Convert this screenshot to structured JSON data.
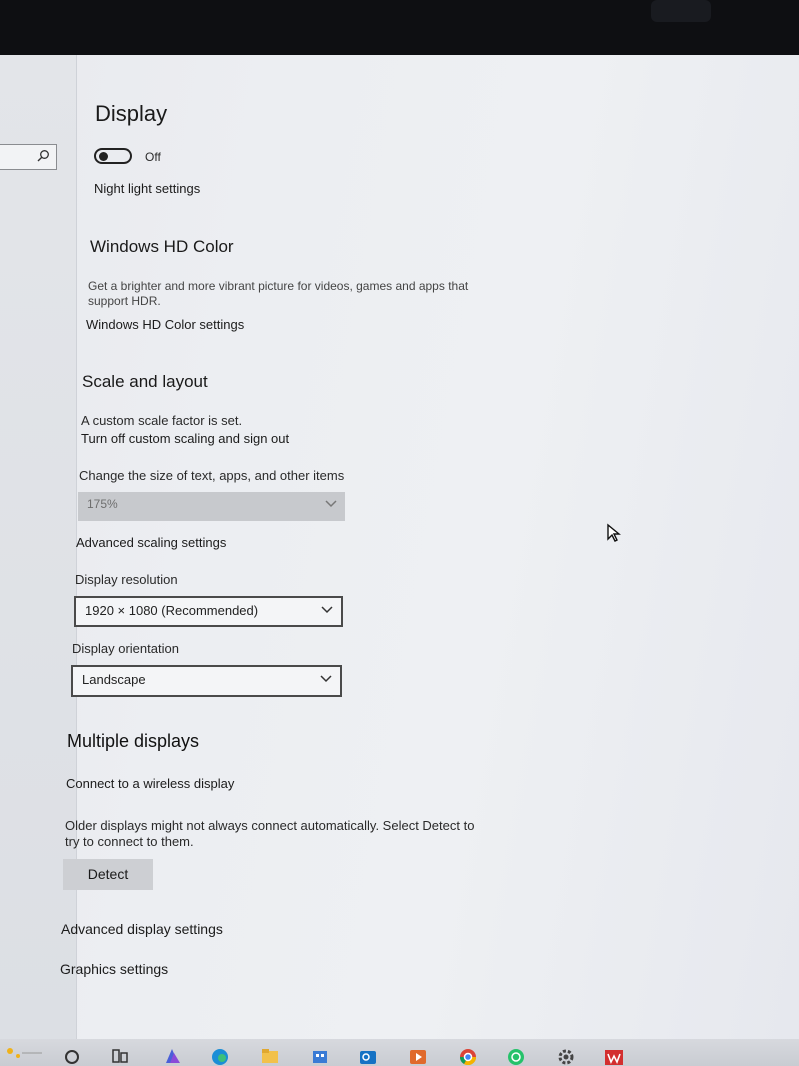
{
  "page": {
    "title": "Display"
  },
  "night_light": {
    "toggle_state": "Off",
    "settings_link": "Night light settings"
  },
  "hd_color": {
    "heading": "Windows HD Color",
    "description_line1": "Get a brighter and more vibrant picture for videos, games and apps that",
    "description_line2": "support HDR.",
    "settings_link": "Windows HD Color settings"
  },
  "scale_layout": {
    "heading": "Scale and layout",
    "custom_notice": "A custom scale factor is set.",
    "turn_off_link": "Turn off custom scaling and sign out",
    "size_label": "Change the size of text, apps, and other items",
    "size_value": "175%",
    "advanced_link": "Advanced scaling settings",
    "resolution_label": "Display resolution",
    "resolution_value": "1920 × 1080 (Recommended)",
    "orientation_label": "Display orientation",
    "orientation_value": "Landscape"
  },
  "multiple_displays": {
    "heading": "Multiple displays",
    "wireless_link": "Connect to a wireless display",
    "detect_note_line1": "Older displays might not always connect automatically. Select Detect to",
    "detect_note_line2": "try to connect to them.",
    "detect_button": "Detect",
    "advanced_display_link": "Advanced display settings",
    "graphics_link": "Graphics settings"
  },
  "taskbar": {
    "icons": [
      "start-icon",
      "search-circle-icon",
      "task-view-icon",
      "app-icon",
      "edge-icon",
      "file-explorer-icon",
      "store-icon",
      "outlook-icon",
      "media-player-icon",
      "chrome-icon",
      "whatsapp-icon",
      "settings-gear-icon",
      "wps-office-icon"
    ]
  },
  "colors": {
    "background": "#eceef2",
    "dropdown_disabled": "#c7c9cd",
    "button": "#cdcfd3",
    "taskbar": "#d0d2d7"
  }
}
